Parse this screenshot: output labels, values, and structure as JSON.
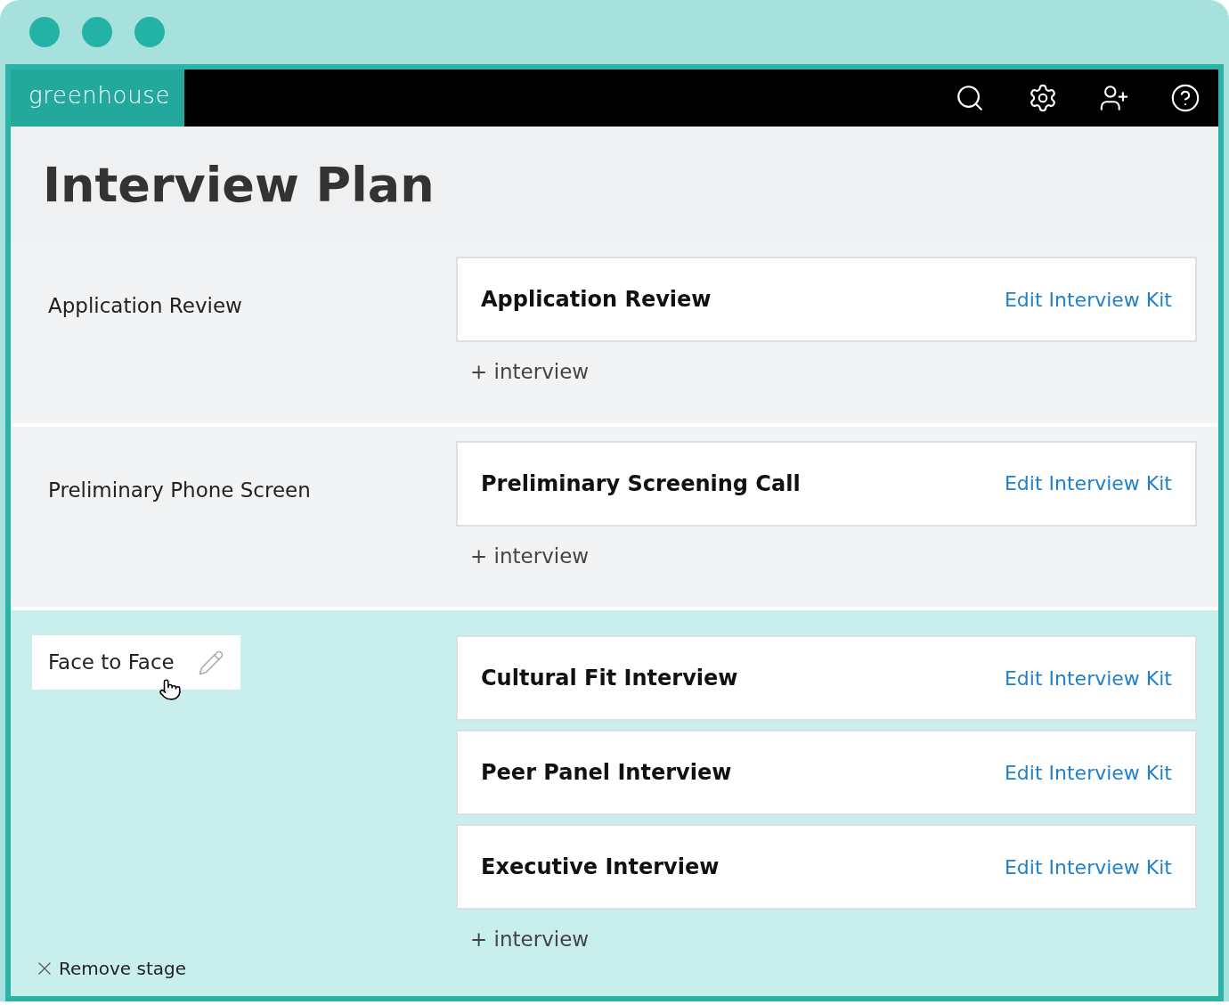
{
  "brand": "greenhouse",
  "title": "Interview Plan",
  "stages": [
    {
      "name": "Application Review",
      "selected": false,
      "interviews": [
        {
          "name": "Application Review",
          "link": "Edit Interview Kit"
        }
      ],
      "add_label": "+ interview"
    },
    {
      "name": "Preliminary Phone Screen",
      "selected": false,
      "interviews": [
        {
          "name": "Preliminary Screening Call",
          "link": "Edit Interview Kit"
        }
      ],
      "add_label": "+ interview"
    },
    {
      "name": "Face to Face",
      "selected": true,
      "interviews": [
        {
          "name": "Cultural Fit Interview",
          "link": "Edit Interview Kit"
        },
        {
          "name": "Peer Panel Interview",
          "link": "Edit Interview Kit"
        },
        {
          "name": "Executive Interview",
          "link": "Edit Interview Kit"
        }
      ],
      "add_label": "+ interview",
      "remove_label": "Remove stage"
    }
  ]
}
